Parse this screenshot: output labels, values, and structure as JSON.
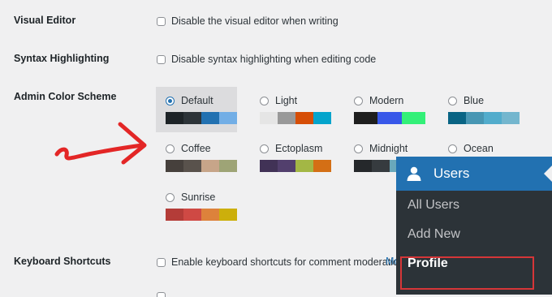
{
  "settings": {
    "visual_editor": {
      "label": "Visual Editor",
      "checkbox_label": "Disable the visual editor when writing"
    },
    "syntax_highlighting": {
      "label": "Syntax Highlighting",
      "checkbox_label": "Disable syntax highlighting when editing code"
    },
    "admin_color_scheme": {
      "label": "Admin Color Scheme",
      "schemes": [
        {
          "name": "Default",
          "selected": true,
          "colors": [
            "#1d2327",
            "#2c3338",
            "#2271b1",
            "#72aee6"
          ]
        },
        {
          "name": "Light",
          "selected": false,
          "colors": [
            "#e5e5e5",
            "#999999",
            "#d64e07",
            "#04a4cc"
          ]
        },
        {
          "name": "Modern",
          "selected": false,
          "colors": [
            "#1e1e1e",
            "#3858e9",
            "#33f078"
          ]
        },
        {
          "name": "Blue",
          "selected": false,
          "colors": [
            "#096484",
            "#4796b3",
            "#52accc",
            "#74b6ce"
          ]
        },
        {
          "name": "Coffee",
          "selected": false,
          "colors": [
            "#46403c",
            "#59524c",
            "#c7a589",
            "#9ea476"
          ]
        },
        {
          "name": "Ectoplasm",
          "selected": false,
          "colors": [
            "#413256",
            "#523f6d",
            "#a3b745",
            "#d46f15"
          ]
        },
        {
          "name": "Midnight",
          "selected": false,
          "colors": [
            "#25282b",
            "#363b3f",
            "#69a8bb",
            "#e14d43"
          ]
        },
        {
          "name": "Ocean",
          "selected": false,
          "colors": [
            "#627c83",
            "#738e96",
            "#9ebaa0",
            "#aa9d88"
          ]
        },
        {
          "name": "Sunrise",
          "selected": false,
          "colors": [
            "#b43c38",
            "#cf4944",
            "#dd823b",
            "#ccaf0b"
          ]
        }
      ]
    },
    "keyboard_shortcuts": {
      "label": "Keyboard Shortcuts",
      "checkbox_label": "Enable keyboard shortcuts for comment moderation.",
      "overflow_link": "Mo"
    }
  },
  "admin_menu": {
    "header": "Users",
    "items": [
      {
        "label": "All Users",
        "current": false
      },
      {
        "label": "Add New",
        "current": false
      },
      {
        "label": "Profile",
        "current": true
      }
    ]
  },
  "colors": {
    "accent": "#2271b1",
    "highlight": "#d63638",
    "arrow": "#e32626"
  }
}
